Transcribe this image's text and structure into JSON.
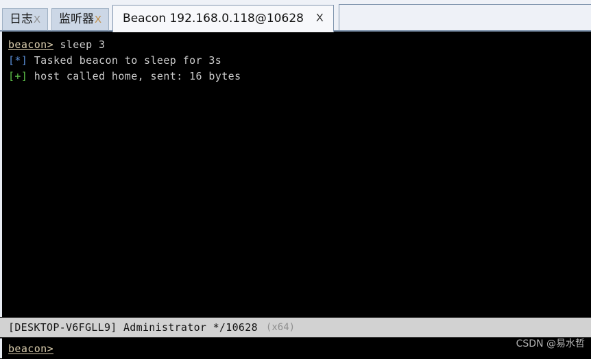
{
  "tabbar": {
    "tabs": [
      {
        "label": "日志",
        "close": "X",
        "active": false
      },
      {
        "label": "监听器",
        "close": "X",
        "active": false
      },
      {
        "label": "Beacon 192.168.0.118@10628",
        "close": "X",
        "active": true
      }
    ]
  },
  "terminal": {
    "lines": [
      {
        "prompt": "beacon>",
        "text": " sleep 3"
      },
      {
        "marker": "[*]",
        "marker_kind": "info",
        "text": " Tasked beacon to sleep for 3s"
      },
      {
        "marker": "[+]",
        "marker_kind": "good",
        "text": " host called home, sent: 16 bytes"
      }
    ]
  },
  "statusbar": {
    "text": "[DESKTOP-V6FGLL9] Administrator */10628",
    "arch": "(x64)"
  },
  "input": {
    "prompt": "beacon>",
    "value": "",
    "placeholder": ""
  },
  "watermark": {
    "text": "CSDN @易水哲"
  },
  "colors": {
    "terminal_bg": "#000000",
    "terminal_fg": "#cccccc",
    "prompt_fg": "#ddd0b0",
    "marker_info": "#5a8ed6",
    "marker_good": "#5fc24a",
    "tabbar_bg": "#eef1f7",
    "tab_inactive_bg": "#ccd7e6",
    "tab_active_bg": "#f7f8fb",
    "statusbar_bg": "#d2d2d2",
    "statusbar_fg": "#141414",
    "status_arch_fg": "#8f8f8f",
    "border": "#7f94ad"
  }
}
